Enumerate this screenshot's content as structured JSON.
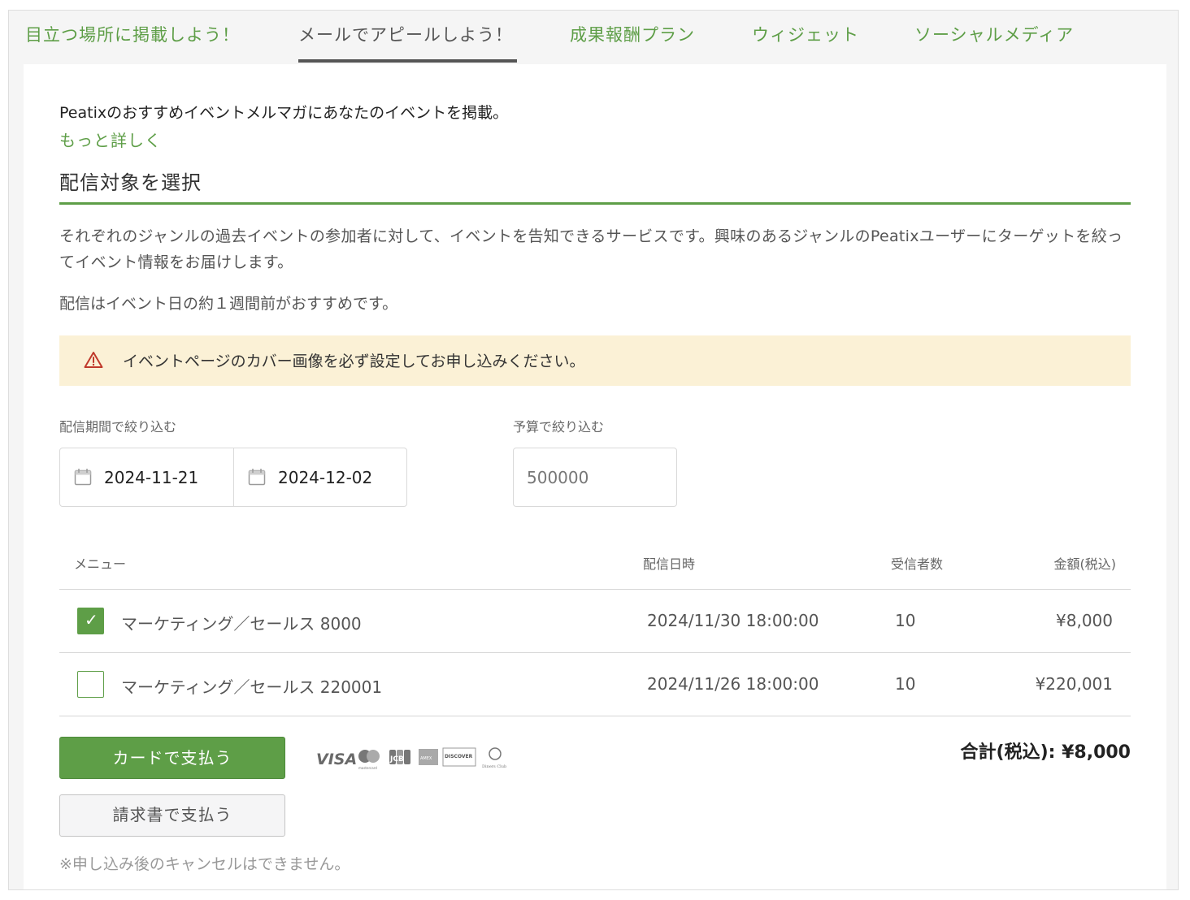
{
  "tabs": [
    {
      "label": "目立つ場所に掲載しよう！",
      "active": false
    },
    {
      "label": "メールでアピールしよう！",
      "active": true
    },
    {
      "label": "成果報酬プラン",
      "active": false
    },
    {
      "label": "ウィジェット",
      "active": false
    },
    {
      "label": "ソーシャルメディア",
      "active": false
    }
  ],
  "intro": {
    "text": "Peatixのおすすめイベントメルマガにあなたのイベントを掲載。",
    "more_link": "もっと詳しく"
  },
  "section": {
    "title": "配信対象を選択",
    "description": "それぞれのジャンルの過去イベントの参加者に対して、イベントを告知できるサービスです。興味のあるジャンルのPeatixユーザーにターゲットを絞ってイベント情報をお届けします。",
    "recommendation": "配信はイベント日の約１週間前がおすすめです。"
  },
  "notice": {
    "icon": "warning-icon",
    "text": "イベントページのカバー画像を必ず設定してお申し込みください。"
  },
  "filters": {
    "period_label": "配信期間で絞り込む",
    "start_date": "2024-11-21",
    "end_date": "2024-12-02",
    "budget_label": "予算で絞り込む",
    "budget_value": "500000"
  },
  "table": {
    "headers": {
      "menu": "メニュー",
      "date": "配信日時",
      "count": "受信者数",
      "price": "金額(税込)"
    },
    "rows": [
      {
        "checked": true,
        "menu": "マーケティング／セールス 8000",
        "date": "2024/11/30 18:00:00",
        "count": "10",
        "price": "¥8,000"
      },
      {
        "checked": false,
        "menu": "マーケティング／セールス 220001",
        "date": "2024/11/26 18:00:00",
        "count": "10",
        "price": "¥220,001"
      }
    ]
  },
  "actions": {
    "card_button": "カードで支払う",
    "invoice_button": "請求書で支払う",
    "total": "合計(税込): ¥8,000",
    "cancel_note": "※申し込み後のキャンセルはできません。"
  },
  "payment_brands": {
    "visa": "VISA",
    "mastercard": "mastercard",
    "jcb": "JCB",
    "amex": "AMEX",
    "discover": "DISCOVER",
    "diners": "Diners Club"
  },
  "colors": {
    "accent": "#5e9e47",
    "notice_bg": "#fbf1d6",
    "warning": "#c0392b"
  }
}
